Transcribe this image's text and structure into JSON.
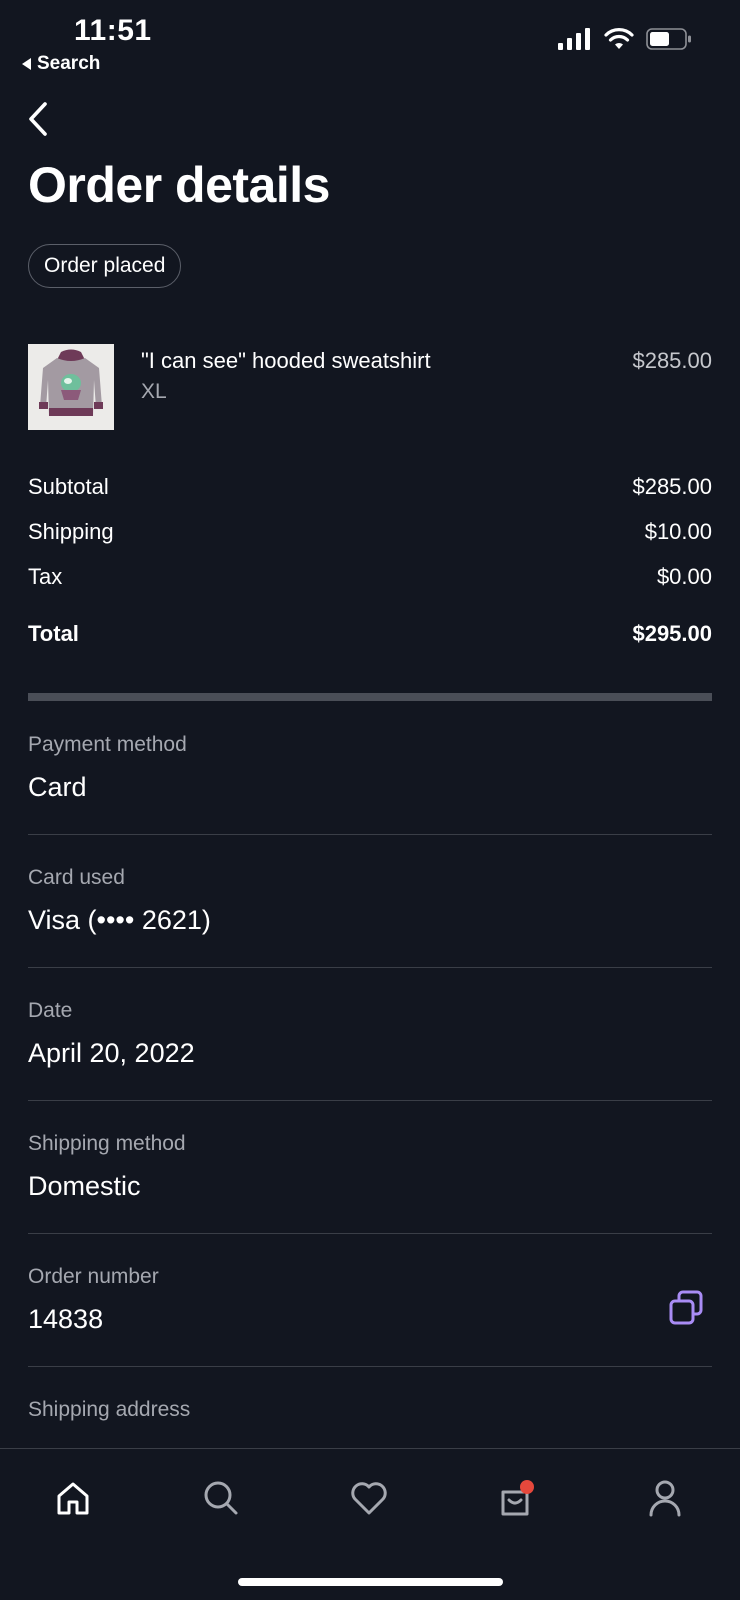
{
  "status": {
    "time": "11:51",
    "back_app": "Search"
  },
  "header": {
    "title": "Order details",
    "status_pill": "Order placed"
  },
  "product": {
    "name": "\"I can see\" hooded sweatshirt",
    "size": "XL",
    "price": "$285.00"
  },
  "summary": {
    "subtotal_label": "Subtotal",
    "subtotal_value": "$285.00",
    "shipping_label": "Shipping",
    "shipping_value": "$10.00",
    "tax_label": "Tax",
    "tax_value": "$0.00",
    "total_label": "Total",
    "total_value": "$295.00"
  },
  "details": [
    {
      "label": "Payment method",
      "value": "Card"
    },
    {
      "label": "Card used",
      "value": "Visa (•••• 2621)"
    },
    {
      "label": "Date",
      "value": "April 20, 2022"
    },
    {
      "label": "Shipping method",
      "value": "Domestic"
    },
    {
      "label": "Order number",
      "value": "14838"
    },
    {
      "label": "Shipping address",
      "value": ""
    }
  ],
  "colors": {
    "background": "#121620",
    "accent": "#a98cf5",
    "badge": "#e5483c",
    "muted_text": "#a5a8b0"
  },
  "tabs": [
    "home-icon",
    "search-icon",
    "heart-icon",
    "bag-icon",
    "profile-icon"
  ]
}
